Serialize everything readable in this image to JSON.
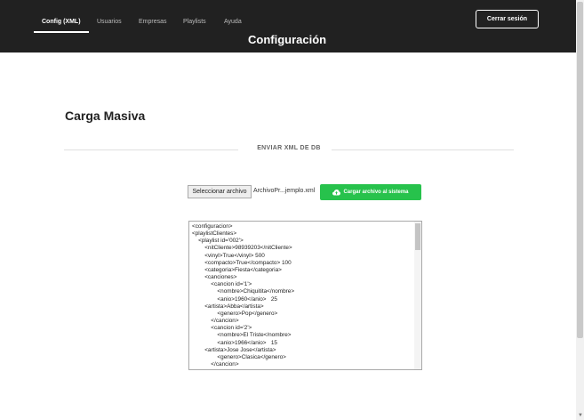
{
  "nav": {
    "items": [
      {
        "label": "Config (XML)",
        "active": true
      },
      {
        "label": "Usuarios",
        "active": false
      },
      {
        "label": "Empresas",
        "active": false
      },
      {
        "label": "Playlists",
        "active": false
      },
      {
        "label": "Ayuda",
        "active": false
      }
    ],
    "title": "Configuración",
    "logout_label": "Cerrar sesión"
  },
  "main": {
    "section_title": "Carga Masiva",
    "divider_label": "ENVIAR XML DE DB",
    "file_input": {
      "button_label": "Seleccionar archivo",
      "file_name": "ArchivoPr...jemplo.xml"
    },
    "upload_button_label": "Cargar archivo al sistema",
    "upload_icon": "cloud-upload-icon",
    "xml_content": "<configuracion>\n<playlistClientes>\n    <playlist id='002'>\n        <nitCliente>98939203</nitCliente>\n        <vinyl>True</vinyl> 500\n        <compacto>True</compacto> 100\n        <categoria>Fiesta</categoria>\n        <canciones>\n            <cancion id='1'>\n                <nombre>Chiquitita</nombre>\n                <anio>1960</anio>   25\n        <artista>Abba</artista>\n                <genero>Pop</genero>\n            </cancion>\n            <cancion id='2'>\n                <nombre>El Triste</nombre>\n                <anio>1966</anio>   15\n        <artista>Jose Jose</artista>\n                <genero>Clasica</genero>\n            </cancion>"
  },
  "colors": {
    "navbar_bg": "#212121",
    "upload_button_bg": "#27c24c"
  }
}
